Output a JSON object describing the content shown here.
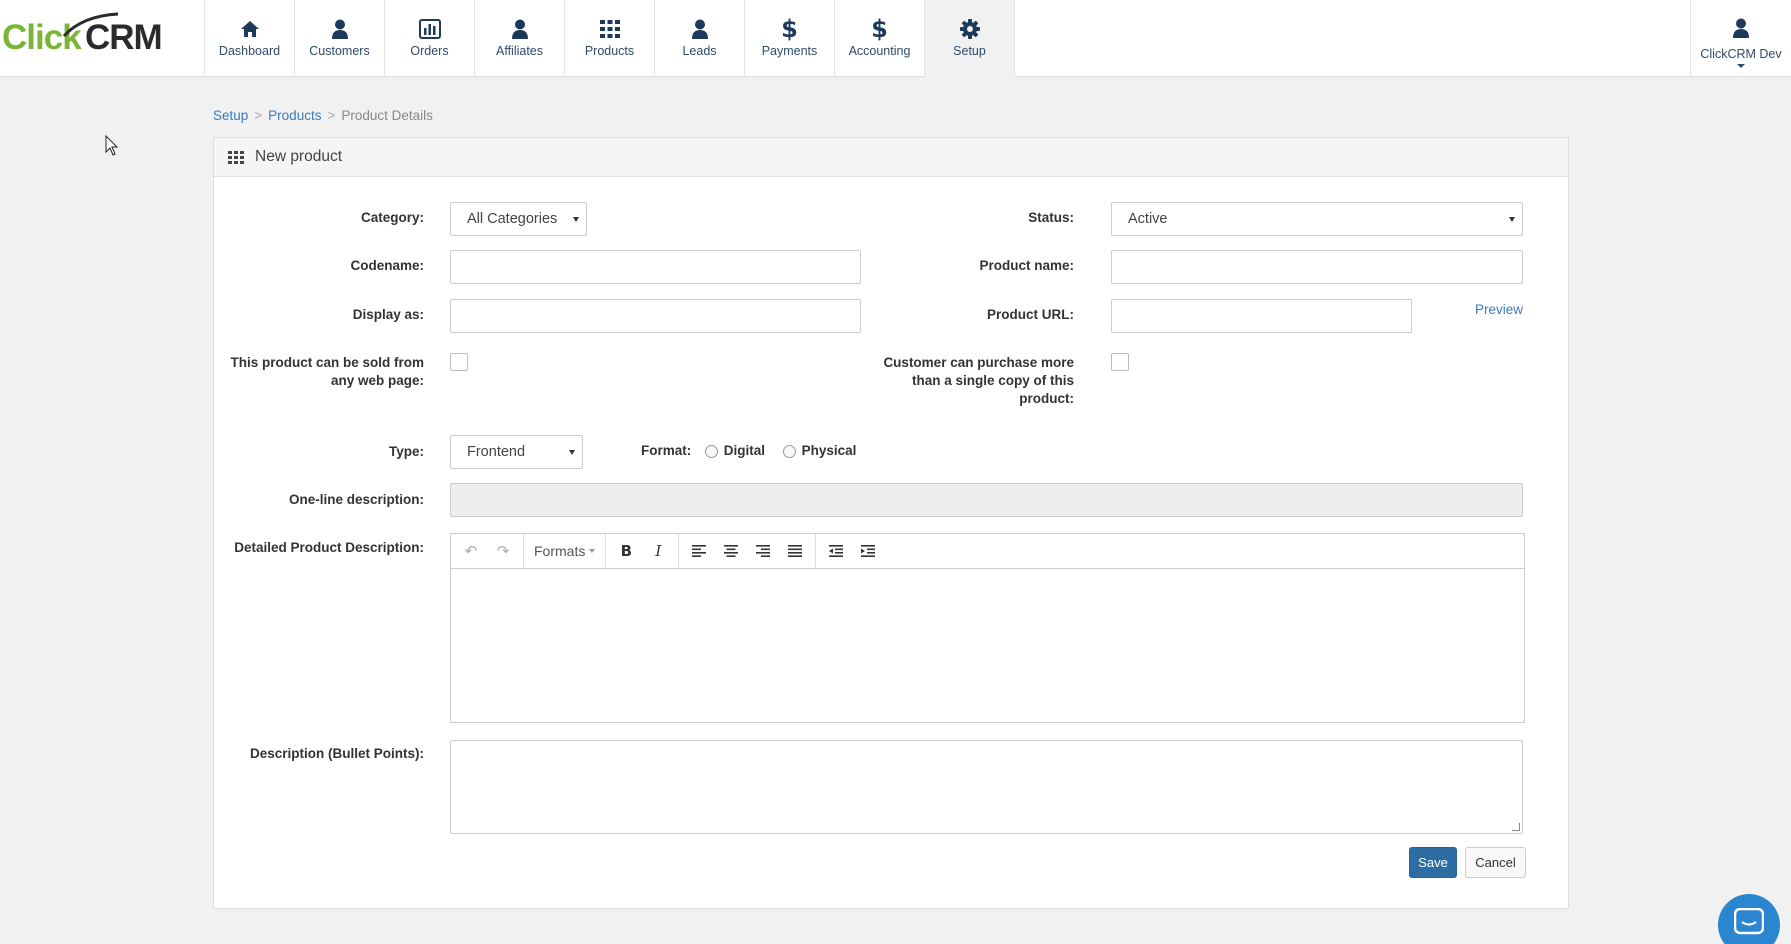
{
  "app": {
    "logo_part1": "Click",
    "logo_part2": "CRM"
  },
  "nav": {
    "items": [
      {
        "label": "Dashboard",
        "icon": "home-icon"
      },
      {
        "label": "Customers",
        "icon": "user-icon"
      },
      {
        "label": "Orders",
        "icon": "bar-chart-icon"
      },
      {
        "label": "Affiliates",
        "icon": "user-icon"
      },
      {
        "label": "Products",
        "icon": "grid-icon"
      },
      {
        "label": "Leads",
        "icon": "user-icon"
      },
      {
        "label": "Payments",
        "icon": "dollar-icon"
      },
      {
        "label": "Accounting",
        "icon": "dollar-icon"
      },
      {
        "label": "Setup",
        "icon": "gear-icon",
        "active": true
      }
    ],
    "user_label": "ClickCRM Dev"
  },
  "breadcrumb": {
    "items": [
      "Setup",
      "Products",
      "Product Details"
    ],
    "separator": ">"
  },
  "panel": {
    "title": "New product"
  },
  "form": {
    "category_label": "Category:",
    "category_value": "All Categories",
    "status_label": "Status:",
    "status_value": "Active",
    "codename_label": "Codename:",
    "codename_value": "",
    "product_name_label": "Product name:",
    "product_name_value": "",
    "display_as_label": "Display as:",
    "display_as_value": "",
    "product_url_label": "Product URL:",
    "product_url_value": "",
    "preview_link": "Preview",
    "sold_anywhere_label_1": "This product can be sold from",
    "sold_anywhere_label_2": "any web page:",
    "multi_copy_label_1": "Customer can purchase more",
    "multi_copy_label_2": "than a single copy of this",
    "multi_copy_label_3": "product:",
    "type_label": "Type:",
    "type_value": "Frontend",
    "format_label": "Format:",
    "format_options": [
      "Digital",
      "Physical"
    ],
    "one_line_label": "One-line description:",
    "detailed_label": "Detailed Product Description:",
    "editor_formats": "Formats",
    "bullets_label": "Description (Bullet Points):",
    "save_label": "Save",
    "cancel_label": "Cancel"
  },
  "colors": {
    "primary": "#2e6da4",
    "link": "#3a7dbd",
    "logo_green": "#7ab538",
    "nav_icon": "#1e3a5a",
    "chat": "#2a86d0"
  }
}
